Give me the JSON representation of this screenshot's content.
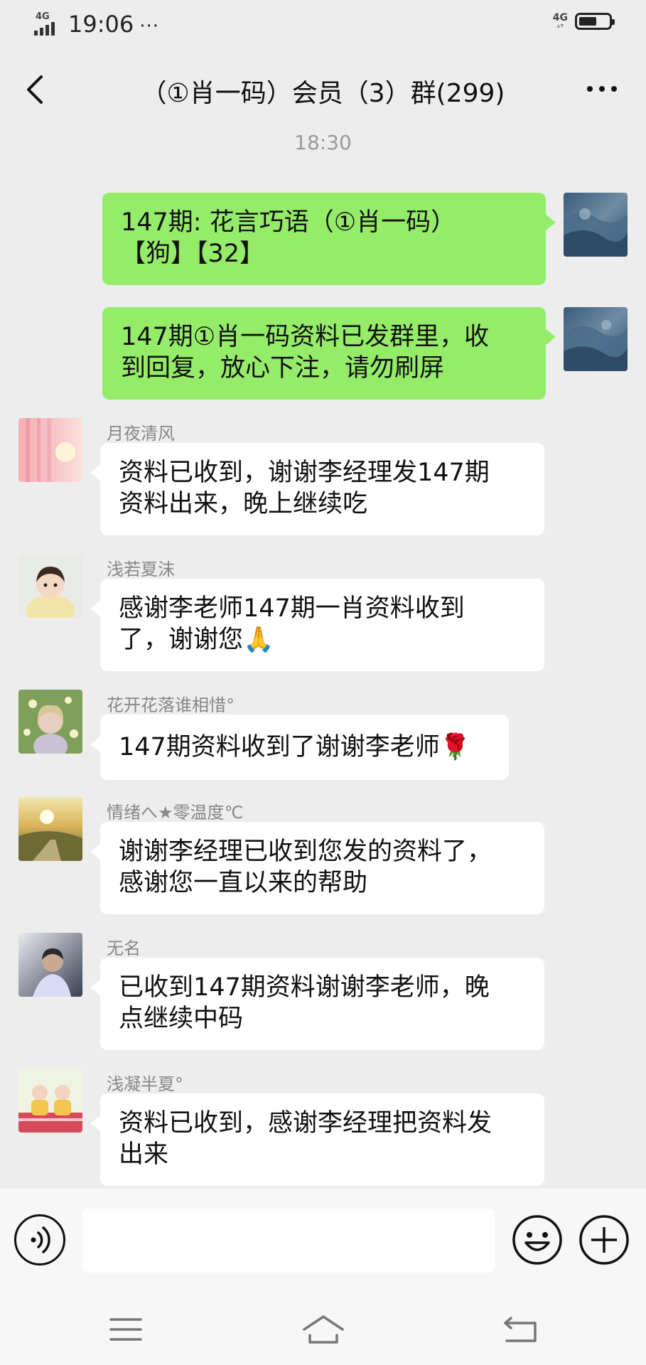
{
  "status_bar": {
    "signal_label": "4G",
    "time": "19:06",
    "dots": "···",
    "network_label": "4G",
    "battery_level": 0.6
  },
  "header": {
    "title": "（①肖一码）会员（3）群(299)"
  },
  "timestamp": "18:30",
  "messages": [
    {
      "sender": "",
      "self": true,
      "text": "147期: 花言巧语（①肖一码）\n【狗】【32】"
    },
    {
      "sender": "",
      "self": true,
      "text": "147期①肖一码资料已发群里，收\n到回复，放心下注，请勿刷屏"
    },
    {
      "sender": "月夜清风",
      "self": false,
      "text": "资料已收到，谢谢李经理发147期\n资料出来，晚上继续吃"
    },
    {
      "sender": "浅若夏沫",
      "self": false,
      "text": "感谢李老师147期一肖资料收到\n了，谢谢您🙏"
    },
    {
      "sender": "花开花落谁相惜°",
      "self": false,
      "text": "147期资料收到了谢谢李老师🌹"
    },
    {
      "sender": "情绪へ★零温度℃",
      "self": false,
      "text": "谢谢李经理已收到您发的资料了，\n感谢您一直以来的帮助"
    },
    {
      "sender": "无名",
      "self": false,
      "text": "已收到147期资料谢谢李老师，晚\n点继续中码"
    },
    {
      "sender": "浅凝半夏°",
      "self": false,
      "text": "资料已收到，感谢李经理把资料发\n出来"
    }
  ],
  "input": {
    "placeholder": "",
    "value": ""
  },
  "colors": {
    "background": "#ededed",
    "self_bubble": "#95ec69",
    "other_bubble": "#ffffff",
    "sender_name": "#888888"
  },
  "icons": {
    "back": "chevron-left-icon",
    "more": "more-dots-icon",
    "voice": "voice-icon",
    "emoji": "emoji-icon",
    "plus": "plus-icon",
    "nav_menu": "menu-icon",
    "nav_home": "home-icon",
    "nav_back": "return-icon"
  }
}
